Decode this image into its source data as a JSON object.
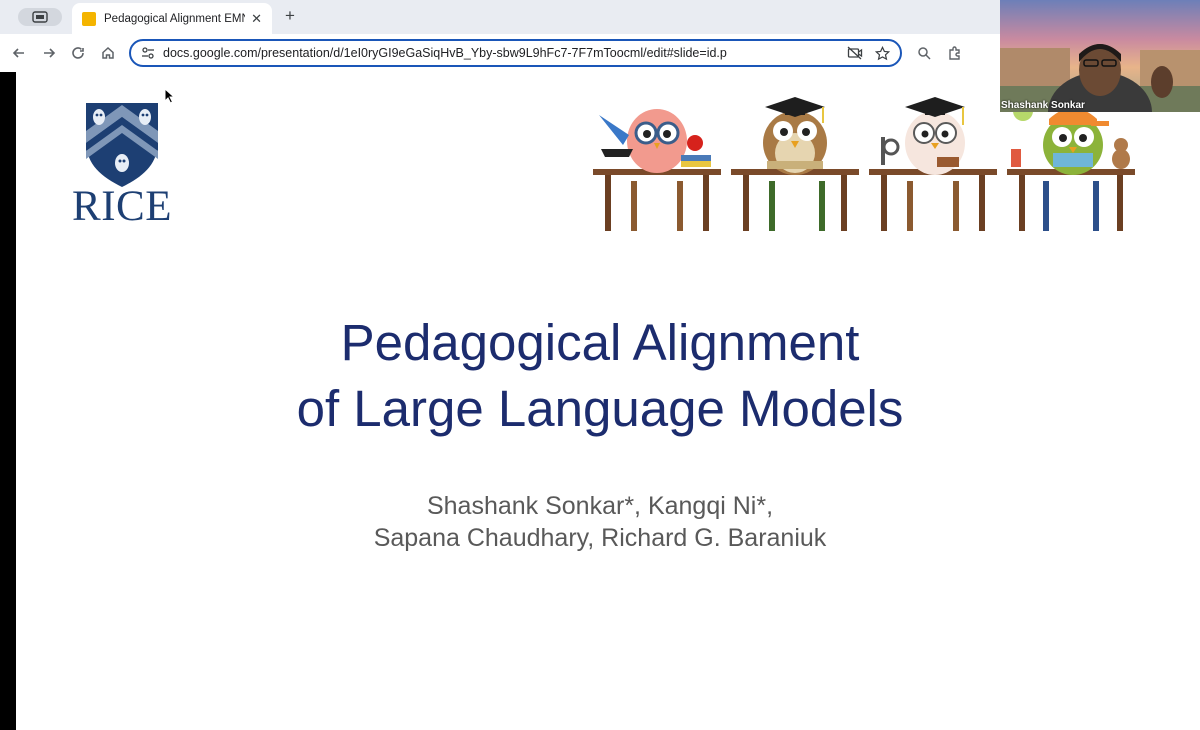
{
  "browser": {
    "tab": {
      "title": "Pedagogical Alignment EMNLP",
      "close_label": "✕"
    },
    "new_tab_label": "+",
    "url": "docs.google.com/presentation/d/1eI0ryGI9eGaSiqHvB_Yby-sbw9L9hFc7-7F7mToocml/edit#slide=id.p"
  },
  "slide": {
    "logo_wordmark": "RICE",
    "title_line1": "Pedagogical Alignment",
    "title_line2": "of Large Language Models",
    "authors_line1": "Shashank Sonkar*, Kangqi Ni*,",
    "authors_line2": "Sapana Chaudhary, Richard G. Baraniuk"
  },
  "video": {
    "participant_name": "Shashank Sonkar"
  },
  "colors": {
    "title": "#1c2c6e",
    "authors": "#595959",
    "rice_blue": "#1d3f73",
    "omnibox_border": "#1a56b8"
  },
  "icons": [
    "tab-switcher-icon",
    "back-icon",
    "forward-icon",
    "reload-icon",
    "home-icon",
    "site-settings-icon",
    "no-camera-icon",
    "star-icon",
    "search-lens-icon",
    "extensions-icon"
  ]
}
